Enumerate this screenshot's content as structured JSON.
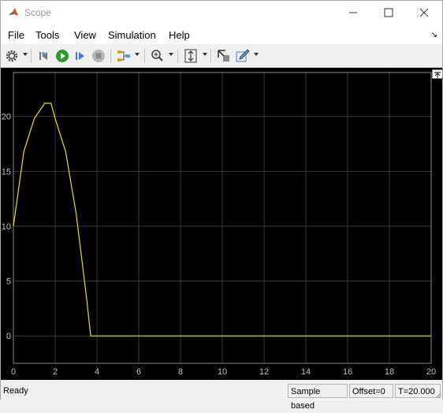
{
  "window": {
    "title": "Scope"
  },
  "menu": {
    "items": [
      "File",
      "Tools",
      "View",
      "Simulation",
      "Help"
    ]
  },
  "toolbar": {
    "icons": [
      "settings-icon",
      "step-back-icon",
      "run-icon",
      "step-forward-icon",
      "stop-icon",
      "signal-selector-icon",
      "zoom-icon",
      "autoscale-icon",
      "highlight-block-icon",
      "style-icon"
    ]
  },
  "chart_data": {
    "type": "line",
    "title": "",
    "xlabel": "",
    "ylabel": "",
    "xlim": [
      0,
      20
    ],
    "ylim": [
      -2.5,
      24
    ],
    "xticks": [
      0,
      2,
      4,
      6,
      8,
      10,
      12,
      14,
      16,
      18,
      20
    ],
    "yticks": [
      0,
      5,
      10,
      15,
      20
    ],
    "grid": true,
    "background": "#000000",
    "line_color": "#e6e600",
    "series": [
      {
        "x": [
          0,
          0.5,
          1.0,
          1.5,
          1.8,
          2.0,
          2.5,
          3.0,
          3.5,
          3.7,
          20
        ],
        "y": [
          10,
          16.8,
          19.8,
          21.2,
          21.2,
          19.8,
          16.8,
          11.2,
          3.5,
          0,
          0
        ]
      }
    ]
  },
  "status": {
    "ready": "Ready",
    "mode": "Sample based",
    "offset": "Offset=0",
    "time": "T=20.000"
  },
  "colors": {
    "plot_bg": "#000000",
    "grid": "#3a3a3a",
    "axis_text": "#c0c0c0",
    "trace": "#e6e600"
  }
}
